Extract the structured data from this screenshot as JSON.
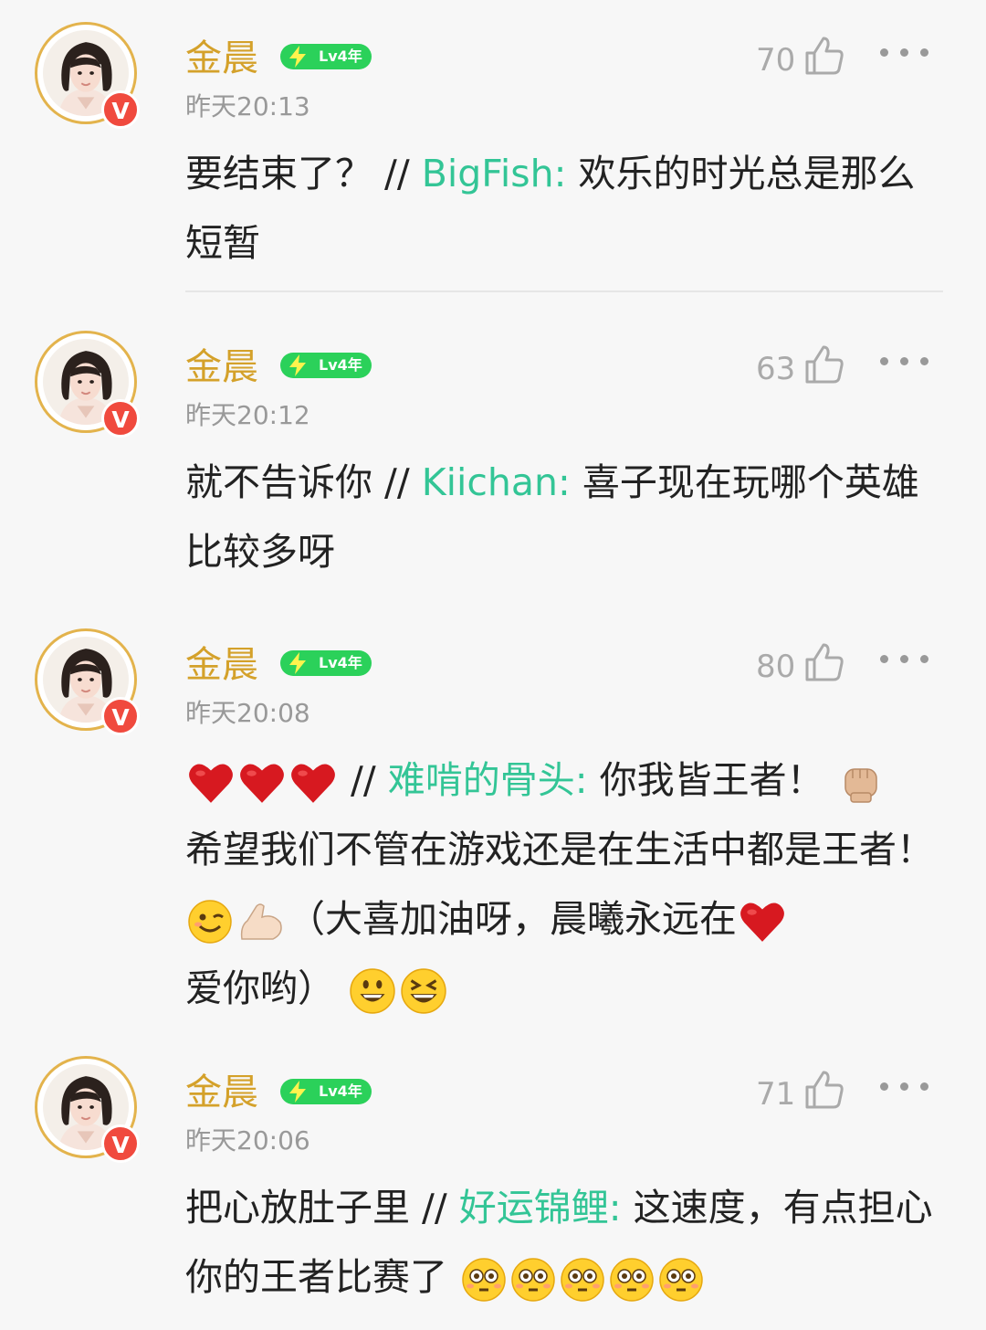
{
  "comments": [
    {
      "user": "金晨",
      "level": "Lv4年",
      "time": "昨天20:13",
      "likes": "70",
      "text": "要结束了？ ",
      "sep": "// ",
      "mention": "BigFish:",
      "quote": " 欢乐的时光总是那么短暂"
    },
    {
      "user": "金晨",
      "level": "Lv4年",
      "time": "昨天20:12",
      "likes": "63",
      "text": "就不告诉你 ",
      "sep": "// ",
      "mention": "Kiichan:",
      "quote": " 喜子现在玩哪个英雄比较多呀"
    },
    {
      "user": "金晨",
      "level": "Lv4年",
      "time": "昨天20:08",
      "likes": "80",
      "text": "",
      "sep": " // ",
      "mention": "难啃的骨头:",
      "quote1": " 你我皆王者！",
      "quote2": "希望我们不管在游戏还是在生活中都是王者！",
      "quote3": "（大喜加油呀，晨曦永远在",
      "quote4": "爱你哟）"
    },
    {
      "user": "金晨",
      "level": "Lv4年",
      "time": "昨天20:06",
      "likes": "71",
      "text": "把心放肚子里 ",
      "sep": "// ",
      "mention": "好运锦鲤:",
      "quote": " 这速度，有点担心你的王者比赛了"
    }
  ],
  "badge": "V",
  "icons": [
    "avatar-image",
    "verified-badge",
    "bolt-icon",
    "thumb-up-icon",
    "more-icon",
    "heart-emoji",
    "fist-emoji",
    "wink-emoji",
    "muscle-emoji",
    "grin-emoji",
    "laugh-emoji",
    "flushed-emoji"
  ],
  "colors": {
    "name": "#d4a12a",
    "mention": "#33c596",
    "level_badge": "#2bd15a",
    "verified": "#f04a3e"
  }
}
